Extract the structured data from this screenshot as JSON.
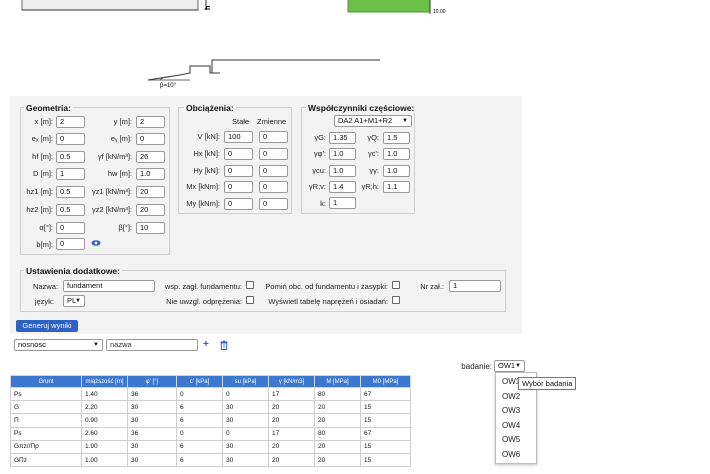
{
  "drawing": {
    "beta_label": "β=10°",
    "axis_tick": "10.00",
    "h_label": "h"
  },
  "geometry": {
    "title": "Geometria:",
    "fields": [
      {
        "label": "x [m]:",
        "value": "2"
      },
      {
        "label": "y [m]:",
        "value": "2"
      },
      {
        "label": "eₓ [m]:",
        "value": "0"
      },
      {
        "label": "eᵧ [m]:",
        "value": "0"
      },
      {
        "label": "hf [m]:",
        "value": "0.5"
      },
      {
        "label": "γf [kN/m³]:",
        "value": "26"
      },
      {
        "label": "D [m]:",
        "value": "1"
      },
      {
        "label": "hw [m]:",
        "value": "1.0"
      },
      {
        "label": "hz1 [m]:",
        "value": "0.5"
      },
      {
        "label": "γz1 [kN/m³]:",
        "value": "20"
      },
      {
        "label": "hz2 [m]:",
        "value": "0.5"
      },
      {
        "label": "γz2 [kN/m³]:",
        "value": "20"
      },
      {
        "label": "α[°]:",
        "value": "0"
      },
      {
        "label": "β[°]:",
        "value": "10"
      },
      {
        "label": "b[m]:",
        "value": "0"
      }
    ]
  },
  "loads": {
    "title": "Obciążenia:",
    "col_static": "Stałe",
    "col_variable": "Zmienne",
    "rows": [
      {
        "label": "V [kN]:",
        "static": "100",
        "variable": "0"
      },
      {
        "label": "Hx [kN]:",
        "static": "0",
        "variable": "0"
      },
      {
        "label": "Hy [kN]:",
        "static": "0",
        "variable": "0"
      },
      {
        "label": "Mx [kNm]:",
        "static": "0",
        "variable": "0"
      },
      {
        "label": "My [kNm]:",
        "static": "0",
        "variable": "0"
      }
    ]
  },
  "factors": {
    "title": "Współczynniki częściowe:",
    "approach": "DA2 A1+M1+R2",
    "rows": [
      {
        "l1": "γG:",
        "v1": "1.35",
        "l2": "γQ:",
        "v2": "1.5"
      },
      {
        "l1": "γφ':",
        "v1": "1.0",
        "l2": "γc':",
        "v2": "1.0"
      },
      {
        "l1": "γcu:",
        "v1": "1.0",
        "l2": "γγ:",
        "v2": "1.0"
      },
      {
        "l1": "γR;v:",
        "v1": "1.4",
        "l2": "γR;h:",
        "v2": "1.1"
      }
    ],
    "k_label": "k:",
    "k_value": "1"
  },
  "extra": {
    "title": "Ustawienia dodatkowe:",
    "name_label": "Nazwa:",
    "name_value": "fundament",
    "lang_label": "język:",
    "lang_value": "PL",
    "opt1": "wsp. zagł. fundamentu:",
    "opt2": "Pomiń obc. od fundamentu i zasypki:",
    "opt3": "Nie uwzgl. odprężenia:",
    "opt4": "Wyświetl tabelę naprężeń i osiadań:",
    "att_label": "Nr zał.:",
    "att_value": "1"
  },
  "generate_button": "Generuj wyniki",
  "filter": {
    "select_value": "nosnosc",
    "name_placeholder": "nazwa"
  },
  "study": {
    "label": "badanie:",
    "value": "OW1"
  },
  "table": {
    "headers": [
      "Grunt",
      "miąższość [m]",
      "φ' [°]",
      "c' [kPa]",
      "su [kPa]",
      "γ [kN/m3]",
      "M [MPa]",
      "M0 [MPa]"
    ],
    "rows": [
      [
        "Ps",
        "1.40",
        "36",
        "0",
        "0",
        "17",
        "80",
        "67"
      ],
      [
        "G",
        "2.20",
        "30",
        "6",
        "30",
        "20",
        "20",
        "15"
      ],
      [
        "Π",
        "0.90",
        "30",
        "6",
        "30",
        "20",
        "20",
        "15"
      ],
      [
        "Ps",
        "2.60",
        "36",
        "0",
        "0",
        "17",
        "80",
        "67"
      ],
      [
        "Gπz//Πp",
        "1.90",
        "30",
        "6",
        "30",
        "20",
        "20",
        "15"
      ],
      [
        "GΠz",
        "1.00",
        "30",
        "6",
        "30",
        "20",
        "20",
        "15"
      ]
    ]
  },
  "dropdown": {
    "options": [
      "OW1",
      "OW2",
      "OW3",
      "OW4",
      "OW5",
      "OW6"
    ],
    "tooltip": "Wybór badania"
  },
  "colors": {
    "accent": "#2d62c4",
    "table_header": "#3c78d0",
    "green_block": "#6cc04a"
  }
}
